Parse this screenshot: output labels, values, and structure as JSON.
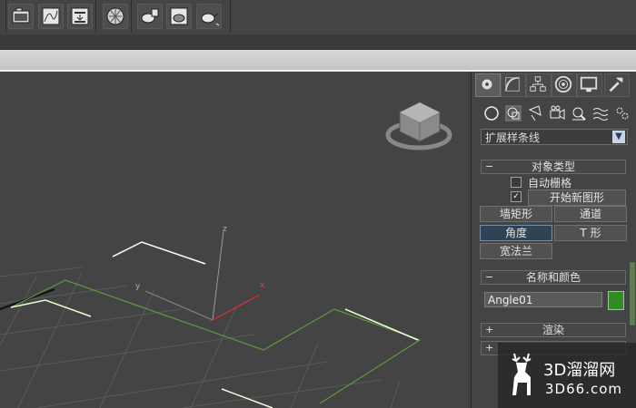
{
  "toolbar": {
    "icons": [
      "render-setup-icon",
      "curve-editor-icon",
      "render-frame-icon",
      "material-editor-icon",
      "render-production-icon",
      "render-iterative-icon",
      "teapot-render-icon"
    ]
  },
  "viewport": {
    "axis_labels": {
      "z": "z",
      "y": "y",
      "x": "x"
    }
  },
  "panel": {
    "tabs": [
      "create-tab",
      "modify-tab",
      "hierarchy-tab",
      "motion-tab",
      "display-tab",
      "utilities-tab"
    ],
    "category_dropdown": "扩展样条线",
    "object_type": {
      "title": "对象类型",
      "autogrid_label": "自动栅格",
      "start_new_shape_label": "开始新图形",
      "buttons": [
        "墙矩形",
        "通道",
        "角度",
        "T 形",
        "宽法兰"
      ]
    },
    "name_and_color": {
      "title": "名称和颜色",
      "name_value": "Angle01",
      "color": "#2d8c22"
    },
    "rendering": {
      "title": "渲染"
    }
  },
  "watermark": {
    "line1": "3D溜溜网",
    "line2": "3D66.com"
  }
}
